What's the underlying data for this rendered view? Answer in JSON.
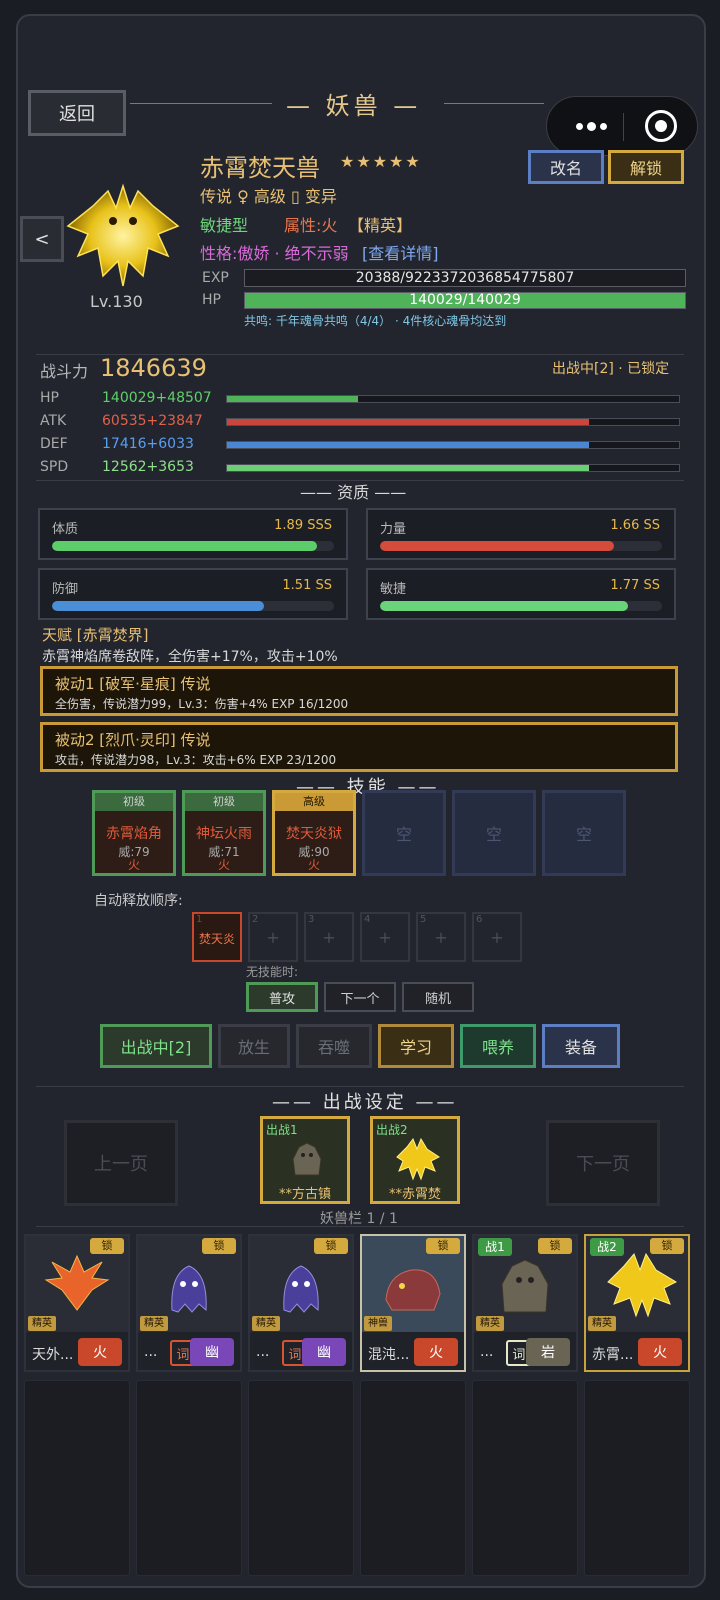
{
  "header": {
    "title": "妖兽",
    "back_label": "返回"
  },
  "capsule": {
    "more_icon": "ellipsis-icon",
    "close_icon": "target-icon"
  },
  "beast": {
    "name": "赤霄焚天兽",
    "stars": "★★★★★",
    "level": "Lv.130",
    "tags1": "传说 ♀ 高级 ▯ 变异",
    "type": "敏捷型",
    "attribute": "属性:火",
    "elite": "【精英】",
    "personality": "性格:傲娇 · 绝不示弱",
    "detail_link": "[查看详情]",
    "rename_label": "改名",
    "unlock_label": "解锁",
    "prev_label": "<",
    "exp_label": "EXP",
    "exp_value": "20388/9223372036854775807",
    "exp_fraction": 0.0,
    "hp_label": "HP",
    "hp_value": "140029/140029",
    "hp_fraction": 1.0,
    "resonance": "共鸣: 千年魂骨共鸣（4/4） · 4件核心魂骨均达到"
  },
  "combat": {
    "power_label": "战斗力",
    "power_value": "1846639",
    "status": "出战中[2] · 已锁定",
    "stats": [
      {
        "label": "HP",
        "value": "140029+48507",
        "color": "#5fcf6a",
        "bar_color": "#4fb35a",
        "fraction": 0.29
      },
      {
        "label": "ATK",
        "value": "60535+23847",
        "color": "#e0624a",
        "bar_color": "#c9463c",
        "fraction": 0.8
      },
      {
        "label": "DEF",
        "value": "17416+6033",
        "color": "#5a9ef0",
        "bar_color": "#4a86d6",
        "fraction": 0.8
      },
      {
        "label": "SPD",
        "value": "12562+3653",
        "color": "#8ee08a",
        "bar_color": "#6ccf74",
        "fraction": 0.8
      }
    ]
  },
  "aptitude": {
    "title": "资质",
    "items": [
      {
        "name": "体质",
        "value": "1.89 SSS",
        "fraction": 0.94,
        "color": "#5ccd6a"
      },
      {
        "name": "力量",
        "value": "1.66 SS",
        "fraction": 0.83,
        "color": "#d54b3c"
      },
      {
        "name": "防御",
        "value": "1.51 SS",
        "fraction": 0.75,
        "color": "#4a8ed8"
      },
      {
        "name": "敏捷",
        "value": "1.77 SS",
        "fraction": 0.88,
        "color": "#6ad47a"
      }
    ]
  },
  "talent": {
    "title": "天赋 [赤霄焚界]",
    "desc": "赤霄神焰席卷敌阵，全伤害+17%，攻击+10%",
    "passives": [
      {
        "title": "被动1 [破军·星痕] 传说",
        "desc": "全伤害，传说潜力99，Lv.3：伤害+4% EXP 16/1200"
      },
      {
        "title": "被动2 [烈爪·灵印] 传说",
        "desc": "攻击，传说潜力98，Lv.3：攻击+6% EXP 23/1200"
      }
    ]
  },
  "skills": {
    "title": "技能",
    "cards": [
      {
        "tier": "初级",
        "name": "赤霄焰角",
        "power": "威:79",
        "elem": "火"
      },
      {
        "tier": "初级",
        "name": "神坛火雨",
        "power": "威:71",
        "elem": "火"
      },
      {
        "tier": "高级",
        "name": "焚天炎狱",
        "power": "威:90",
        "elem": "火"
      }
    ],
    "empty_label": "空",
    "order_label": "自动释放顺序:",
    "order_first_num": "1",
    "order_first": "焚天炎",
    "order_nums": [
      "2",
      "3",
      "4",
      "5",
      "6"
    ],
    "order_plus": "+",
    "no_skill_label": "无技能时:",
    "fallback_options": [
      "普攻",
      "下一个",
      "随机"
    ]
  },
  "actions": [
    "出战中[2]",
    "放生",
    "吞噬",
    "学习",
    "喂养",
    "装备"
  ],
  "deploy": {
    "title": "出战设定",
    "prev_page": "上一页",
    "next_page": "下一页",
    "slots": [
      {
        "tag": "出战1",
        "name": "**方古镇"
      },
      {
        "tag": "出战2",
        "name": "**赤霄焚"
      }
    ],
    "bar_label": "妖兽栏 1 / 1"
  },
  "roster": [
    {
      "name": "天外...",
      "rank": "精英",
      "lock": "锁",
      "elem": "火",
      "elem_color": "#c9482c",
      "battle": "",
      "word": ""
    },
    {
      "name": "...",
      "rank": "精英",
      "lock": "锁",
      "elem": "幽",
      "elem_color": "#7a47b8",
      "battle": "",
      "word": "词1"
    },
    {
      "name": "...",
      "rank": "精英",
      "lock": "锁",
      "elem": "幽",
      "elem_color": "#7a47b8",
      "battle": "",
      "word": "词1"
    },
    {
      "name": "混沌...",
      "rank": "神兽",
      "lock": "锁",
      "elem": "火",
      "elem_color": "#c9482c",
      "battle": "",
      "word": ""
    },
    {
      "name": "...",
      "rank": "精英",
      "lock": "锁",
      "elem": "岩",
      "elem_color": "#6a6454",
      "battle": "战1",
      "word": "词2"
    },
    {
      "name": "赤霄...",
      "rank": "精英",
      "lock": "锁",
      "elem": "火",
      "elem_color": "#c9482c",
      "battle": "战2",
      "word": ""
    }
  ]
}
